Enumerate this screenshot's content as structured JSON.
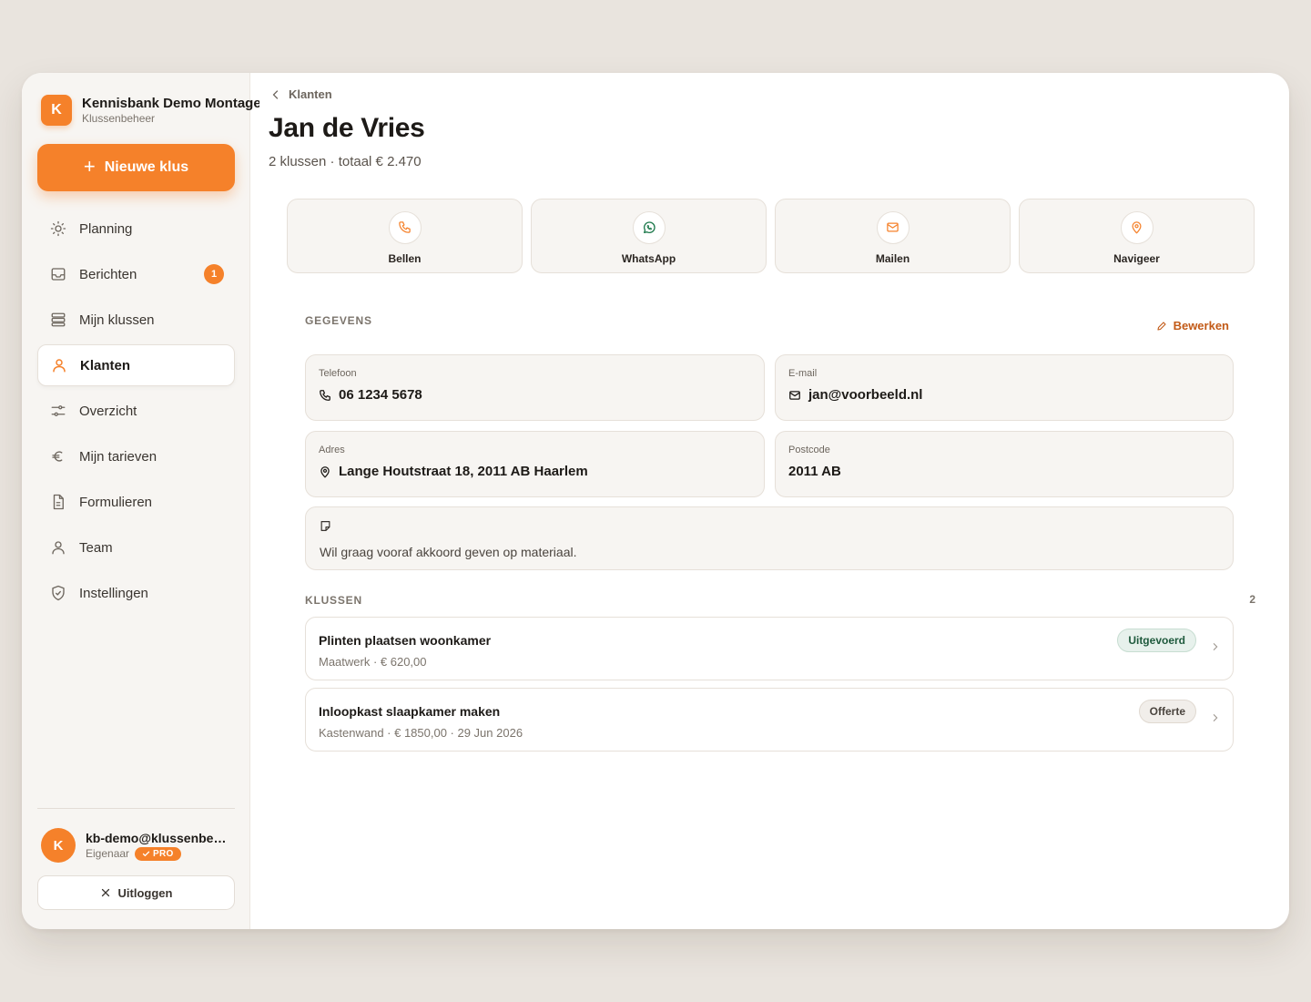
{
  "brand": {
    "logo_letter": "K",
    "name": "Kennisbank Demo Montage",
    "subtitle": "Klussenbeheer"
  },
  "new_button": {
    "label": "Nieuwe klus"
  },
  "nav": {
    "items": [
      {
        "label": "Planning",
        "icon": "sun-icon"
      },
      {
        "label": "Berichten",
        "icon": "inbox-icon",
        "badge": "1"
      },
      {
        "label": "Mijn klussen",
        "icon": "stack-icon"
      },
      {
        "label": "Klanten",
        "icon": "user-icon",
        "active": true
      },
      {
        "label": "Overzicht",
        "icon": "sliders-icon"
      },
      {
        "label": "Mijn tarieven",
        "icon": "euro-icon"
      },
      {
        "label": "Formulieren",
        "icon": "document-icon"
      },
      {
        "label": "Team",
        "icon": "team-icon"
      },
      {
        "label": "Instellingen",
        "icon": "shield-icon"
      }
    ]
  },
  "user": {
    "avatar_letter": "K",
    "email": "kb-demo@klussenbeheer.nl",
    "role": "Eigenaar",
    "plan_badge": "PRO"
  },
  "logout": {
    "label": "Uitloggen"
  },
  "breadcrumb": {
    "back_label": "Klanten"
  },
  "customer": {
    "name": "Jan de Vries",
    "summary": "2 klussen · totaal € 2.470"
  },
  "actions": [
    {
      "label": "Bellen",
      "icon": "phone-icon"
    },
    {
      "label": "WhatsApp",
      "icon": "whatsapp-icon"
    },
    {
      "label": "Mailen",
      "icon": "mail-icon"
    },
    {
      "label": "Navigeer",
      "icon": "map-pin-icon"
    }
  ],
  "details": {
    "section_label": "GEGEVENS",
    "edit_label": "Bewerken",
    "phone": {
      "label": "Telefoon",
      "value": "06 1234 5678"
    },
    "email": {
      "label": "E-mail",
      "value": "jan@voorbeeld.nl"
    },
    "address": {
      "label": "Adres",
      "value": "Lange Houtstraat 18, 2011 AB Haarlem"
    },
    "postcode": {
      "label": "Postcode",
      "value": "2011 AB"
    },
    "note": "Wil graag vooraf akkoord geven op materiaal."
  },
  "jobs": {
    "section_label": "KLUSSEN",
    "count": "2",
    "items": [
      {
        "title": "Plinten plaatsen woonkamer",
        "meta": "Maatwerk · € 620,00",
        "status": "Uitgevoerd"
      },
      {
        "title": "Inloopkast slaapkamer maken",
        "meta": "Kastenwand · € 1850,00 · 29 Jun 2026",
        "status": "Offerte"
      }
    ]
  },
  "colors": {
    "accent": "#f5812a",
    "accent_dark": "#c25a17",
    "status_done": "#1f5a3d",
    "whatsapp": "#1f7a4d"
  }
}
